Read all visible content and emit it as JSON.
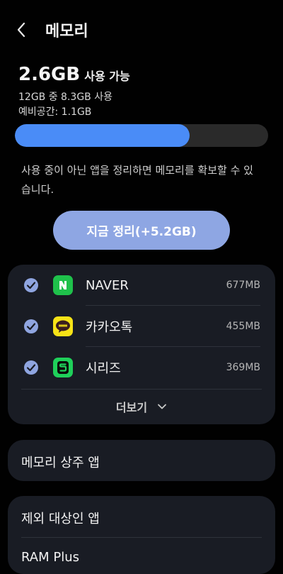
{
  "header": {
    "title": "메모리",
    "back_icon": "chevron-left-icon"
  },
  "memory": {
    "available": "2.6GB",
    "available_suffix": "사용 가능",
    "usage": "12GB 중 8.3GB 사용",
    "reserved": "예비공간: 1.1GB",
    "used_fraction": 0.69,
    "bar_color": "#4a8cf7"
  },
  "description": "사용 중이 아닌 앱을 정리하면 메모리를 확보할 수 있습니다.",
  "clean_button": {
    "label": "지금 정리(+5.2GB)"
  },
  "apps": [
    {
      "name": "NAVER",
      "size": "677MB",
      "icon": "naver-icon",
      "checked": true,
      "icon_color": "#1fc14b"
    },
    {
      "name": "카카오톡",
      "size": "455MB",
      "icon": "kakaotalk-icon",
      "checked": true,
      "icon_color": "#f7e317"
    },
    {
      "name": "시리즈",
      "size": "369MB",
      "icon": "series-icon",
      "checked": true,
      "icon_color": "#1fd05a"
    }
  ],
  "more_button": {
    "label": "더보기",
    "icon": "chevron-down-icon"
  },
  "menu": {
    "resident_apps": "메모리 상주 앱",
    "excluded_apps": "제외 대상인 앱",
    "ram_plus": "RAM Plus"
  }
}
